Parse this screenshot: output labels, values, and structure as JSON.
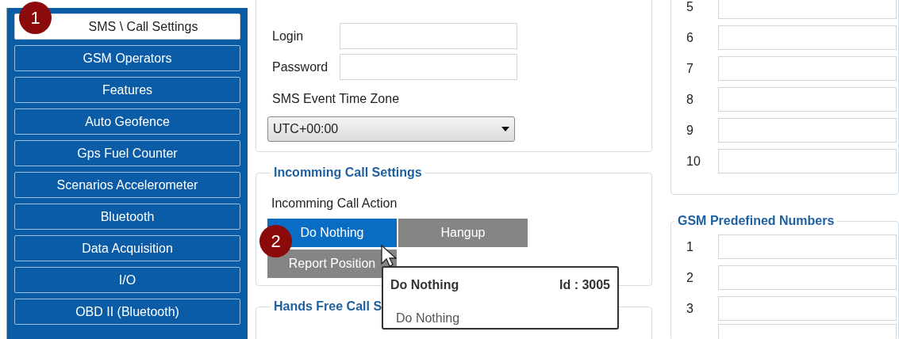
{
  "sidebar": {
    "items": [
      {
        "label": "SMS \\ Call Settings",
        "selected": true,
        "badge": "1"
      },
      {
        "label": "GSM Operators",
        "selected": false
      },
      {
        "label": "Features",
        "selected": false
      },
      {
        "label": "Auto Geofence",
        "selected": false
      },
      {
        "label": "Gps Fuel Counter",
        "selected": false
      },
      {
        "label": "Scenarios Accelerometer",
        "selected": false
      },
      {
        "label": "Bluetooth",
        "selected": false
      },
      {
        "label": "Data Acquisition",
        "selected": false
      },
      {
        "label": "I/O",
        "selected": false
      },
      {
        "label": "OBD II (Bluetooth)",
        "selected": false
      }
    ]
  },
  "sms_commands": {
    "fields": [
      {
        "label": "Login"
      },
      {
        "label": "Password"
      }
    ],
    "time_zone": {
      "label": "SMS Event Time Zone",
      "value": "UTC+00:00"
    }
  },
  "incoming_call_settings": {
    "title": "Incomming Call Settings",
    "action_label": "Incomming Call Action",
    "options": [
      {
        "label": "Do Nothing",
        "selected": true,
        "badge": "2"
      },
      {
        "label": "Hangup",
        "selected": false
      },
      {
        "label": "Report Position",
        "selected": false
      }
    ],
    "tooltip": {
      "title": "Do Nothing",
      "id": "Id : 3005",
      "description": "Do Nothing"
    }
  },
  "hands_free_call_settings": {
    "title": "Hands Free Call S"
  },
  "numbers": {
    "rows": [
      {
        "label": "5"
      },
      {
        "label": "6"
      },
      {
        "label": "7"
      },
      {
        "label": "8"
      },
      {
        "label": "9"
      },
      {
        "label": "10"
      }
    ]
  },
  "gsm_predefined_numbers": {
    "title": "GSM Predefined Numbers",
    "rows": [
      {
        "label": "1"
      },
      {
        "label": "2"
      },
      {
        "label": "3"
      }
    ]
  }
}
